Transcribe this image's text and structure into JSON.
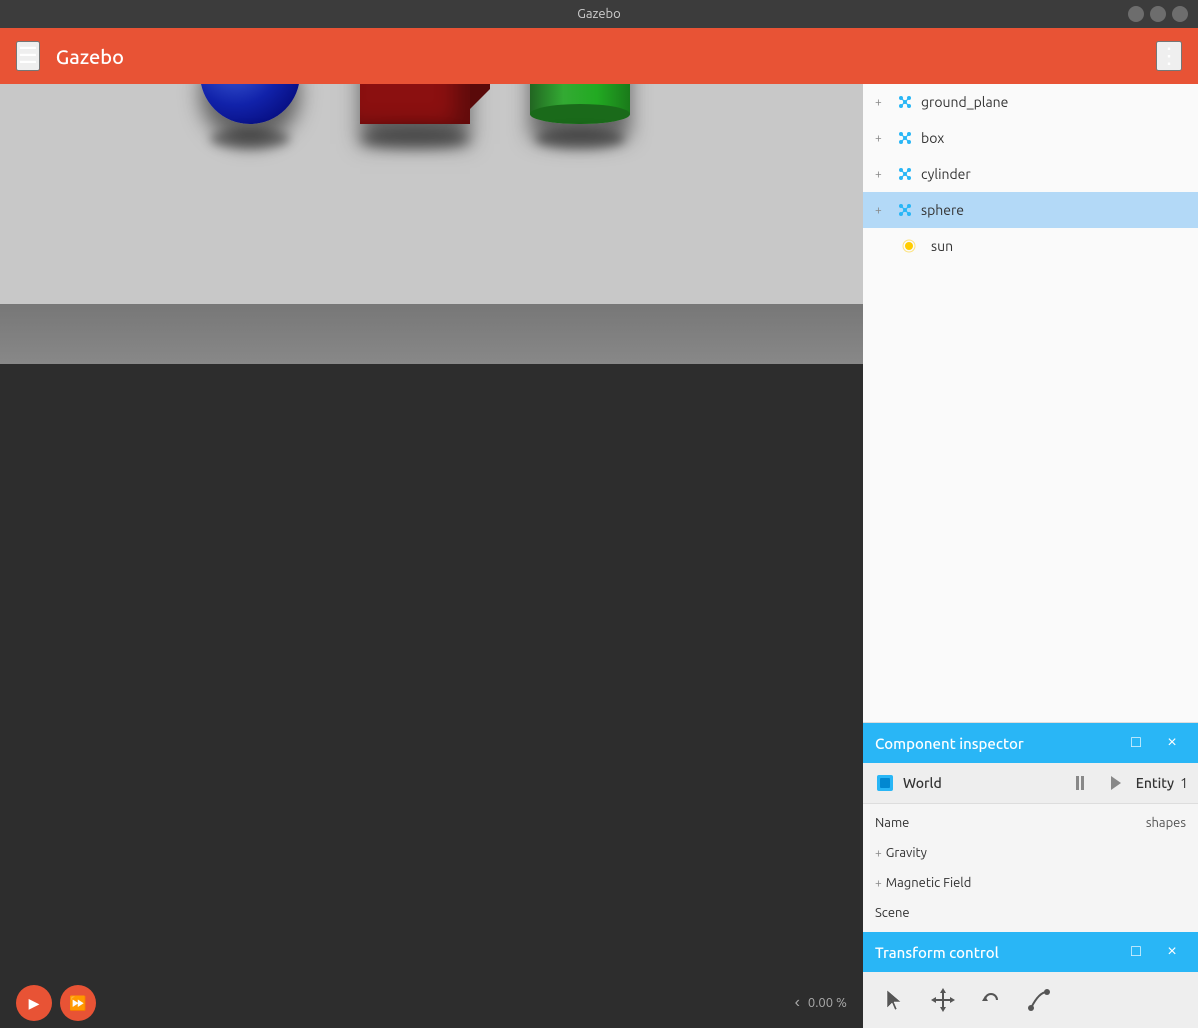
{
  "titlebar": {
    "title": "Gazebo"
  },
  "appbar": {
    "title": "Gazebo",
    "menu_icon": "☰",
    "more_icon": "⋮"
  },
  "entity_tree": {
    "items": [
      {
        "id": "ground_plane",
        "label": "ground_plane",
        "type": "robot",
        "expandable": true
      },
      {
        "id": "box",
        "label": "box",
        "type": "robot",
        "expandable": true
      },
      {
        "id": "cylinder",
        "label": "cylinder",
        "type": "robot",
        "expandable": true
      },
      {
        "id": "sphere",
        "label": "sphere",
        "type": "robot",
        "expandable": true,
        "selected": true
      },
      {
        "id": "sun",
        "label": "sun",
        "type": "light",
        "expandable": false,
        "indent": true
      }
    ]
  },
  "component_inspector": {
    "title": "Component inspector",
    "minimize_icon": "□",
    "close_icon": "×",
    "tabs": {
      "world_label": "World",
      "entity_label": "Entity",
      "entity_number": "1"
    },
    "rows": [
      {
        "key": "Name",
        "value": "shapes",
        "expandable": false
      },
      {
        "key": "Gravity",
        "value": "",
        "expandable": true
      },
      {
        "key": "Magnetic Field",
        "value": "",
        "expandable": true
      },
      {
        "key": "Scene",
        "value": "",
        "expandable": false
      }
    ]
  },
  "transform_control": {
    "title": "Transform control",
    "minimize_icon": "□",
    "close_icon": "×",
    "tools": [
      {
        "id": "select",
        "icon": "↖"
      },
      {
        "id": "translate",
        "icon": "✛"
      },
      {
        "id": "rotate",
        "icon": "↻"
      },
      {
        "id": "scale",
        "icon": "⌒"
      }
    ]
  },
  "bottom_bar": {
    "play_icon": "▶",
    "fastforward_icon": "⏩",
    "nav_left_icon": "‹",
    "percent_value": "0.00 %"
  },
  "scene": {
    "objects": [
      "sphere",
      "box",
      "cylinder"
    ]
  }
}
